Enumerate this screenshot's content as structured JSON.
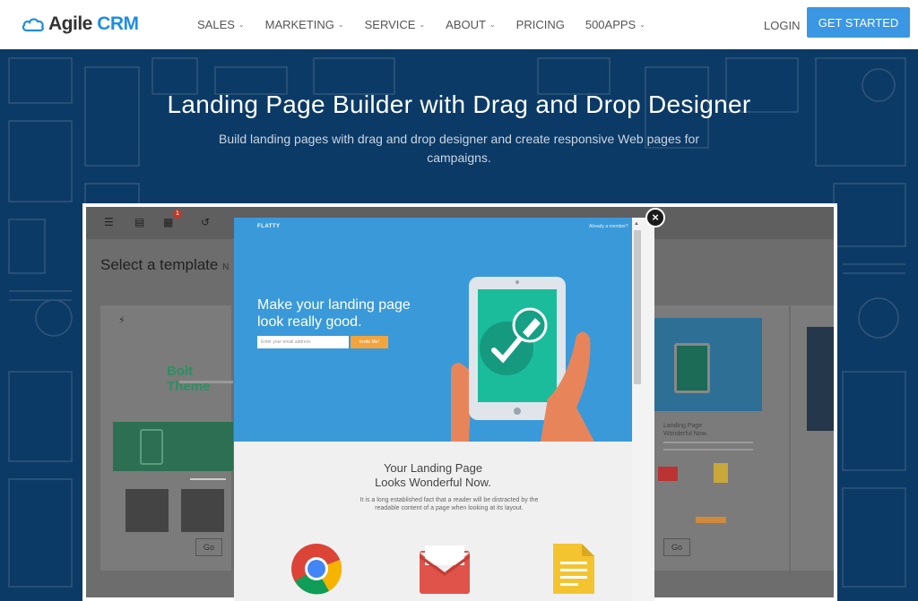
{
  "nav": {
    "logo": {
      "word1": "Agile",
      "word2": "CRM"
    },
    "items": [
      {
        "label": "SALES",
        "has_dropdown": true
      },
      {
        "label": "MARKETING",
        "has_dropdown": true
      },
      {
        "label": "SERVICE",
        "has_dropdown": true
      },
      {
        "label": "ABOUT",
        "has_dropdown": true
      },
      {
        "label": "PRICING",
        "has_dropdown": false
      },
      {
        "label": "500APPS",
        "has_dropdown": true
      }
    ],
    "login": "LOGIN",
    "cta": "GET STARTED"
  },
  "hero": {
    "title": "Landing Page Builder with Drag and Drop Designer",
    "subtitle": "Build landing pages with drag and drop designer and create responsive Web pages for campaigns."
  },
  "builder": {
    "toolbar_badge": "1",
    "select_title": "Select a template",
    "select_suffix": "N",
    "left_card": {
      "name": "Bolt Theme",
      "go": "Go"
    },
    "right_card": {
      "heading_line1": "Landing Page",
      "heading_line2": "Wonderful Now.",
      "go": "Go"
    }
  },
  "preview": {
    "brand": "FLATTY",
    "member_link": "Already a member?",
    "headline": "Make your landing page look really good.",
    "email_placeholder": "Enter your email address",
    "invite_button": "Invite Me!",
    "section_title_line1": "Your Landing Page",
    "section_title_line2": "Looks Wonderful Now.",
    "section_body": "It is a long established fact that a reader will be distracted by the readable content of a page when looking at its layout."
  },
  "colors": {
    "brand_blue": "#3b97e3",
    "hero_bg": "#0c3a66",
    "preview_blue": "#3a99d9",
    "preview_green": "#1abc9c",
    "invite_orange": "#f3a53c"
  }
}
